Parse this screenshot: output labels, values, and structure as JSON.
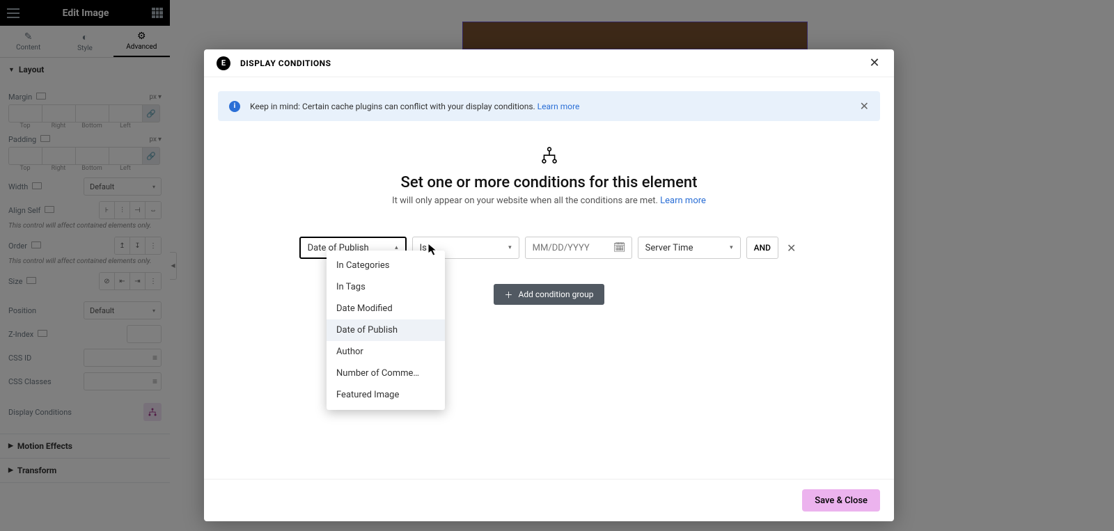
{
  "sidebar": {
    "title": "Edit Image",
    "tabs": [
      {
        "label": "Content",
        "icon": "✎"
      },
      {
        "label": "Style",
        "icon": "◐"
      },
      {
        "label": "Advanced",
        "icon": "⚙"
      }
    ],
    "layout": {
      "heading": "Layout",
      "margin_label": "Margin",
      "padding_label": "Padding",
      "unit": "px",
      "sides": [
        "Top",
        "Right",
        "Bottom",
        "Left"
      ],
      "width_label": "Width",
      "width_value": "Default",
      "align_self_label": "Align Self",
      "hint1": "This control will affect contained elements only.",
      "order_label": "Order",
      "hint2": "This control will affect contained elements only.",
      "size_label": "Size",
      "position_label": "Position",
      "position_value": "Default",
      "zindex_label": "Z-Index",
      "cssid_label": "CSS ID",
      "cssclasses_label": "CSS Classes",
      "display_conditions_label": "Display Conditions"
    },
    "motion_effects": "Motion Effects",
    "transform": "Transform"
  },
  "modal": {
    "title": "DISPLAY CONDITIONS",
    "banner_text": "Keep in mind: Certain cache plugins can conflict with your display conditions. ",
    "learn_more": "Learn more",
    "hero_title": "Set one or more conditions for this element",
    "hero_sub": "It will only appear on your website when all the conditions are met. ",
    "condition": {
      "type_value": "Date of Publish",
      "operator_value": "Is",
      "date_placeholder": "MM/DD/YYYY",
      "time_value": "Server Time",
      "logic": "AND"
    },
    "dropdown_options": [
      "In Categories",
      "In Tags",
      "Date Modified",
      "Date of Publish",
      "Author",
      "Number of Comme…",
      "Featured Image"
    ],
    "add_group": "Add condition group",
    "save": "Save & Close"
  }
}
